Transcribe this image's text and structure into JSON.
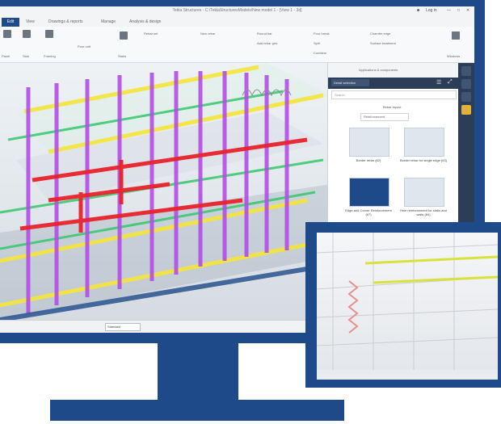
{
  "app": {
    "title": "Tekla Structures - C:\\TeklaStructuresModels\\New model 1 - [View 1 - 3d]",
    "login": "Log in"
  },
  "ribbon": {
    "tabs": [
      "Edit",
      "View",
      "Drawings & reports",
      "Manage",
      "Analysis & design"
    ],
    "groups": {
      "panel": "Panel",
      "slab": "Slab",
      "framing": "Framing",
      "pour_unit": "Pour unit",
      "stairs": "Stairs",
      "rebar_set": "Rebar set",
      "new_rebar": "New rebar",
      "round_bar": "Round bar",
      "add_rebar_grid": "Add rebar grid",
      "pour_break": "Pour break",
      "split": "Split",
      "combine": "Combine",
      "chamfer_edge": "Chamfer edge",
      "surface_treatment": "Surface treatment",
      "windows": "Windows"
    }
  },
  "side_panel": {
    "header": "Applications & components",
    "selector": "Detail selection",
    "search_placeholder": "Search",
    "catalog_title": "Rebar layout",
    "catalog_filter": "Reinforcement",
    "items": [
      {
        "label": "Border rebar (62)",
        "selected": false
      },
      {
        "label": "Border rebar for single edge (63)",
        "selected": false
      },
      {
        "label": "Edge and Corner Reinforcement (67)",
        "selected": true
      },
      {
        "label": "Hole reinforcement for slabs and walls (84)",
        "selected": false
      }
    ]
  },
  "statusbar": {
    "view_mode": "Standard"
  },
  "colors": {
    "frame_blue": "#1f4a8a",
    "column_purple": "#b34ee6",
    "pipe_red": "#e8232c",
    "beam_yellow": "#f5e63a",
    "duct_green": "#34c86b"
  }
}
